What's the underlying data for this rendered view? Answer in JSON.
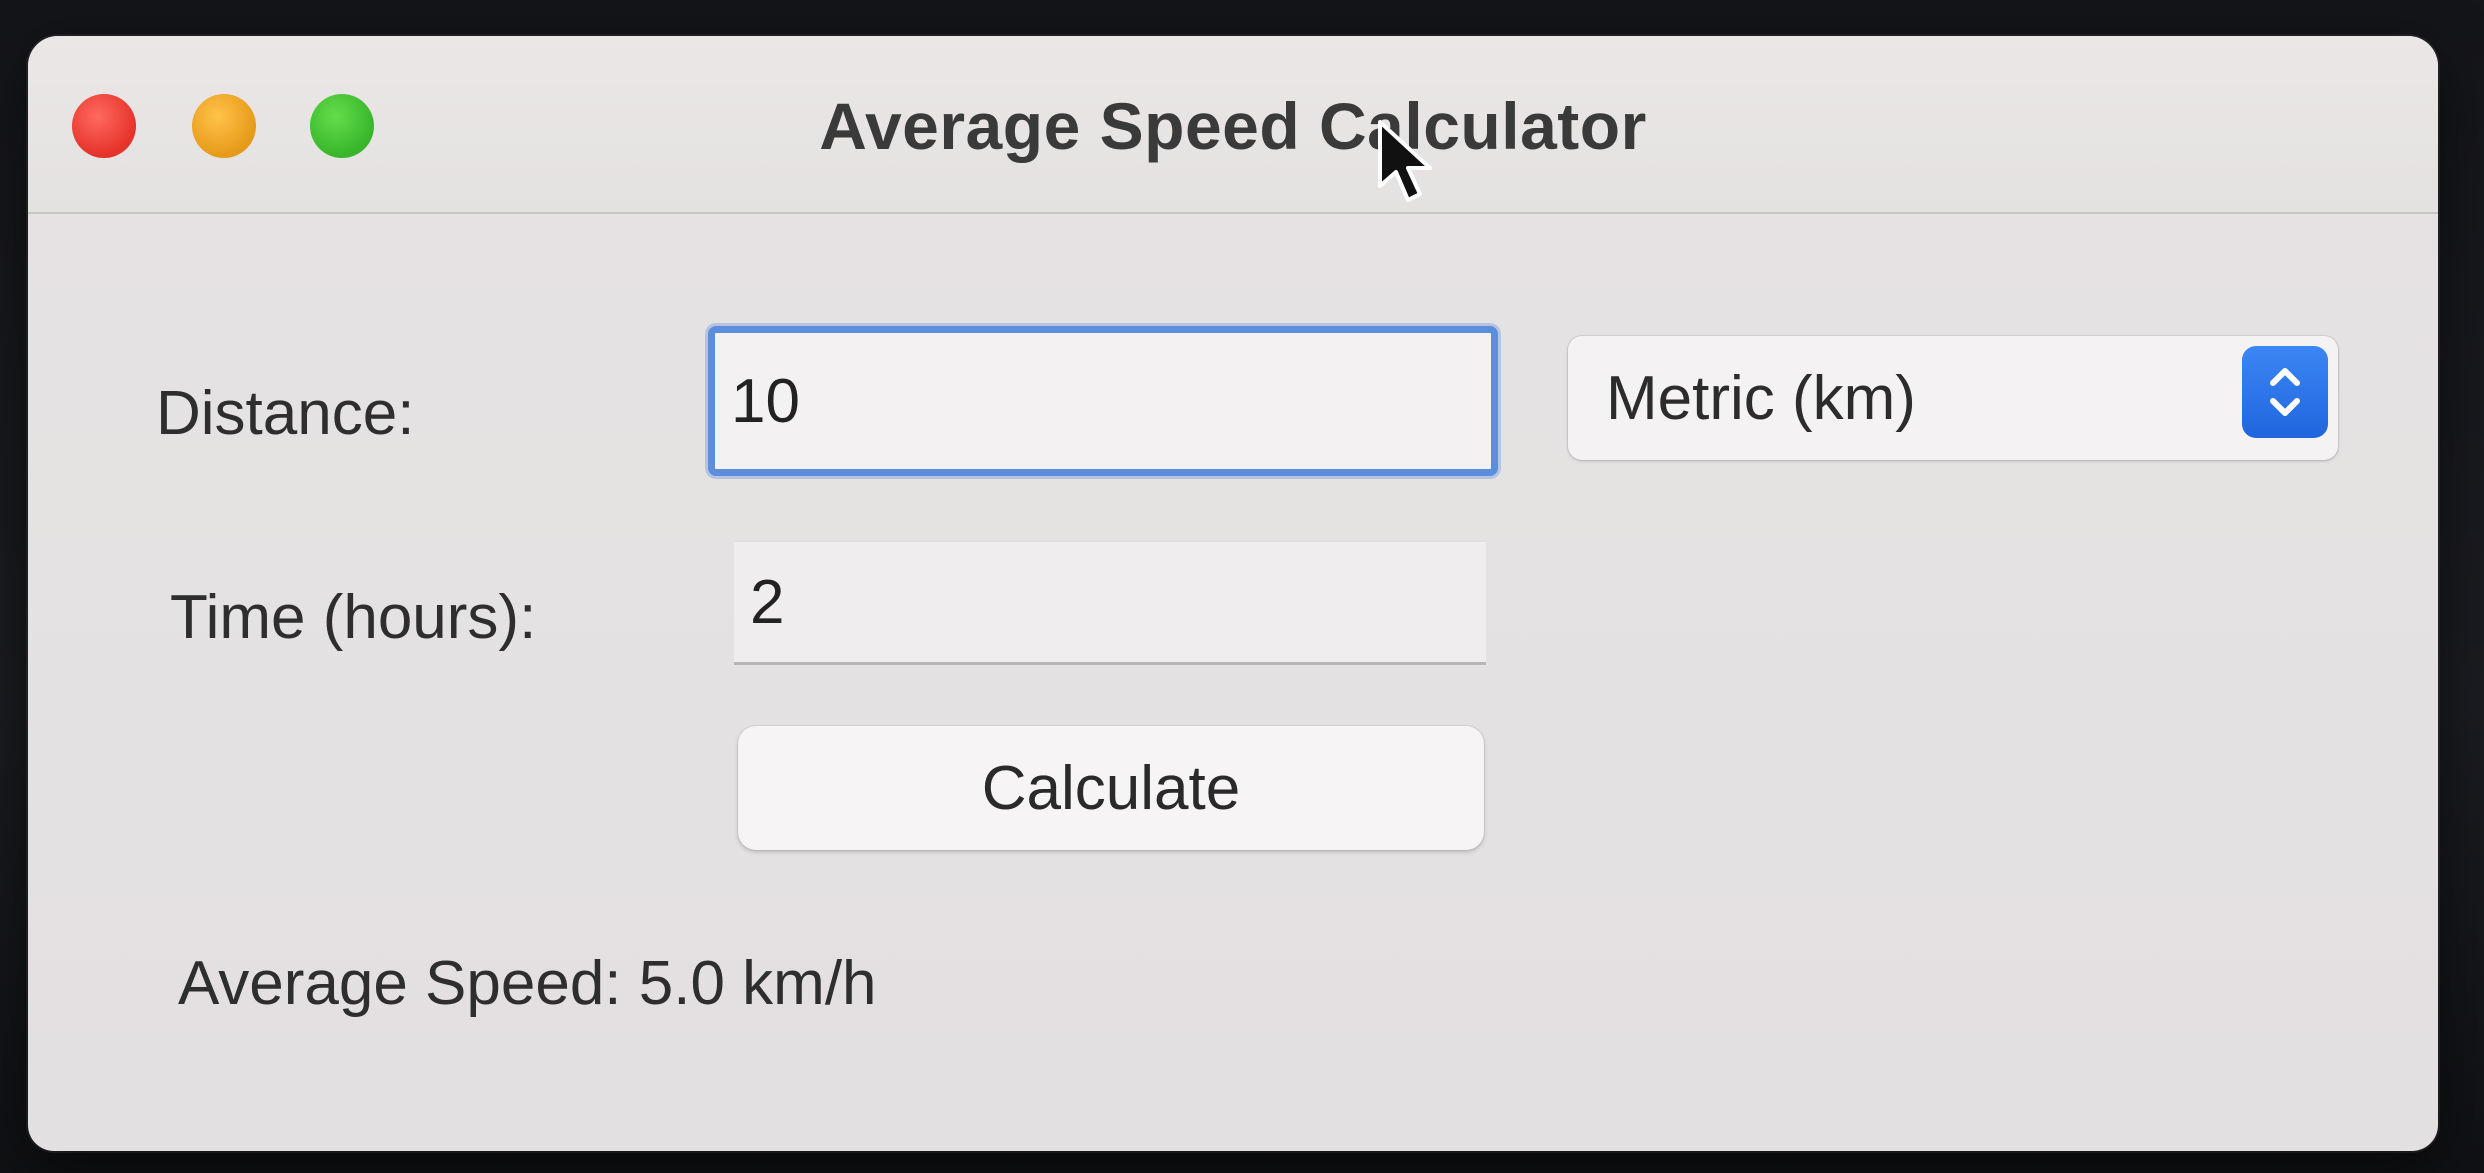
{
  "window": {
    "title": "Average Speed Calculator"
  },
  "form": {
    "distance_label": "Distance:",
    "distance_value": "10",
    "unit_selected": "Metric (km)",
    "time_label": "Time (hours):",
    "time_value": "2",
    "calculate_label": "Calculate"
  },
  "result": {
    "text": "Average Speed: 5.0 km/h"
  },
  "icons": {
    "close": "close-button-icon",
    "minimize": "minimize-button-icon",
    "maximize": "zoom-button-icon",
    "stepper": "up-down-chevron-icon",
    "cursor": "mouse-pointer-icon"
  },
  "colors": {
    "close": "#e5322a",
    "minimize": "#e69a18",
    "maximize": "#38b52a",
    "focus_ring": "#5b8fde",
    "stepper": "#1f66de"
  }
}
